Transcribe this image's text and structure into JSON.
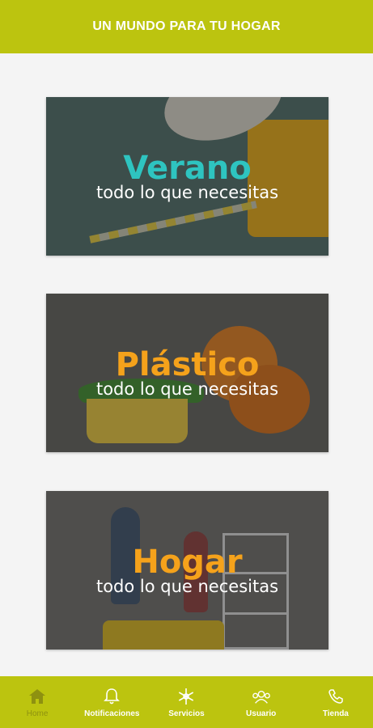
{
  "header": {
    "title": "UN MUNDO PARA TU HOGAR"
  },
  "cards": [
    {
      "title": "Verano",
      "subtitle": "todo lo que necesitas"
    },
    {
      "title": "Plástico",
      "subtitle": "todo lo que necesitas"
    },
    {
      "title": "Hogar",
      "subtitle": "todo lo que necesitas"
    }
  ],
  "nav": {
    "items": [
      {
        "label": "Home",
        "icon": "home-icon",
        "active": true
      },
      {
        "label": "Notificaciones",
        "icon": "bell-icon",
        "active": false
      },
      {
        "label": "Servicios",
        "icon": "snowflake-icon",
        "active": false
      },
      {
        "label": "Usuario",
        "icon": "users-icon",
        "active": false
      },
      {
        "label": "Tienda",
        "icon": "phone-icon",
        "active": false
      }
    ]
  },
  "colors": {
    "brand": "#bcc40f",
    "verano": "#2ec4c0",
    "plastico": "#f5a21b",
    "hogar": "#f5a21b"
  }
}
